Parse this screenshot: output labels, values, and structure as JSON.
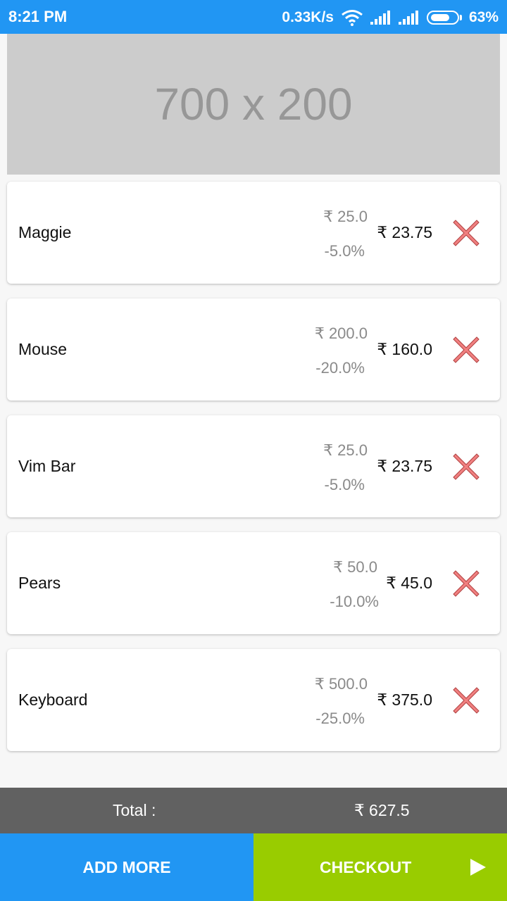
{
  "status_bar": {
    "time": "8:21 PM",
    "net_speed": "0.33K/s",
    "battery": "63%",
    "battery_level": 0.63
  },
  "banner": {
    "text": "700 x 200"
  },
  "cart": {
    "items": [
      {
        "name": "Maggie",
        "original_price": "₹ 25.0",
        "discount": "-5.0%",
        "final_price": "₹ 23.75"
      },
      {
        "name": "Mouse",
        "original_price": "₹ 200.0",
        "discount": "-20.0%",
        "final_price": "₹ 160.0"
      },
      {
        "name": "Vim Bar",
        "original_price": "₹ 25.0",
        "discount": "-5.0%",
        "final_price": "₹ 23.75"
      },
      {
        "name": "Pears",
        "original_price": "₹ 50.0",
        "discount": "-10.0%",
        "final_price": "₹ 45.0"
      },
      {
        "name": "Keyboard",
        "original_price": "₹ 500.0",
        "discount": "-25.0%",
        "final_price": "₹ 375.0"
      }
    ]
  },
  "total": {
    "label": "Total :",
    "value": "₹ 627.5"
  },
  "actions": {
    "add_more": "ADD MORE",
    "checkout": "CHECKOUT"
  },
  "colors": {
    "primary": "#2196f3",
    "checkout": "#99cc00",
    "total_bar": "#616161",
    "remove_icon": "#f08080"
  }
}
